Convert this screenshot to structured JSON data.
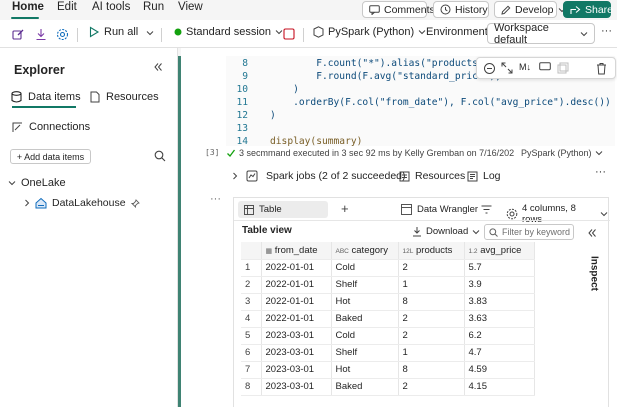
{
  "menu": {
    "tabs": [
      "Home",
      "Edit",
      "AI tools",
      "Run",
      "View"
    ],
    "comments": "Comments",
    "history": "History",
    "develop": "Develop",
    "share": "Share"
  },
  "toolbar": {
    "run_all": "Run all",
    "session": "Standard session",
    "language": "PySpark (Python)",
    "environment": "Environment",
    "workspace": "Workspace default",
    "more": "···"
  },
  "explorer": {
    "title": "Explorer",
    "tab_data": "Data items",
    "tab_resources": "Resources",
    "connections": "Connections",
    "add_data": "+ Add data items",
    "onelake": "OneLake",
    "lakehouse": "DataLakehouse"
  },
  "code": {
    "lines": [
      {
        "n": "8",
        "text": "        F.count(\"*\").alias(\"products\"),"
      },
      {
        "n": "9",
        "text": "        F.round(F.avg(\"standard_price\"), 2"
      },
      {
        "n": "10",
        "text": "    )"
      },
      {
        "n": "11",
        "text": "    .orderBy(F.col(\"from_date\"), F.col(\"avg_price\").desc())"
      },
      {
        "n": "12",
        "text": ")"
      },
      {
        "n": "13",
        "text": ""
      },
      {
        "n": "14",
        "text": "display(summary)"
      }
    ],
    "cell_index": "[3]",
    "exec_status": "3 secmmand executed in 3 sec 92 ms by Kelly Gremban on 7/16/2026, 9:56:31",
    "exec_lang": "PySpark (Python)"
  },
  "output": {
    "spark_jobs": "Spark jobs (2 of 2 succeeded)",
    "resources": "Resources",
    "log": "Log",
    "more": "···",
    "tab_table": "Table",
    "data_wrangler": "Data Wrangler",
    "columns_rows": "4 columns, 8 rows",
    "table_view": "Table view",
    "download": "Download",
    "filter_placeholder": "Filter by keyword",
    "inspect": "Inspect"
  },
  "table": {
    "columns": [
      {
        "type": "▦",
        "name": "from_date"
      },
      {
        "type": "ABC",
        "name": "category"
      },
      {
        "type": "12L",
        "name": "products"
      },
      {
        "type": "1.2",
        "name": "avg_price"
      }
    ],
    "rows": [
      [
        "1",
        "2022-01-01",
        "Cold",
        "2",
        "5.7"
      ],
      [
        "2",
        "2022-01-01",
        "Shelf",
        "1",
        "3.9"
      ],
      [
        "3",
        "2022-01-01",
        "Hot",
        "8",
        "3.83"
      ],
      [
        "4",
        "2022-01-01",
        "Baked",
        "2",
        "3.63"
      ],
      [
        "5",
        "2023-03-01",
        "Cold",
        "2",
        "6.2"
      ],
      [
        "6",
        "2023-03-01",
        "Shelf",
        "1",
        "4.7"
      ],
      [
        "7",
        "2023-03-01",
        "Hot",
        "8",
        "4.59"
      ],
      [
        "8",
        "2023-03-01",
        "Baked",
        "2",
        "4.15"
      ]
    ]
  },
  "colors": {
    "accent": "#117865",
    "code_string": "#a31515",
    "code_text": "#0c4a7a"
  }
}
